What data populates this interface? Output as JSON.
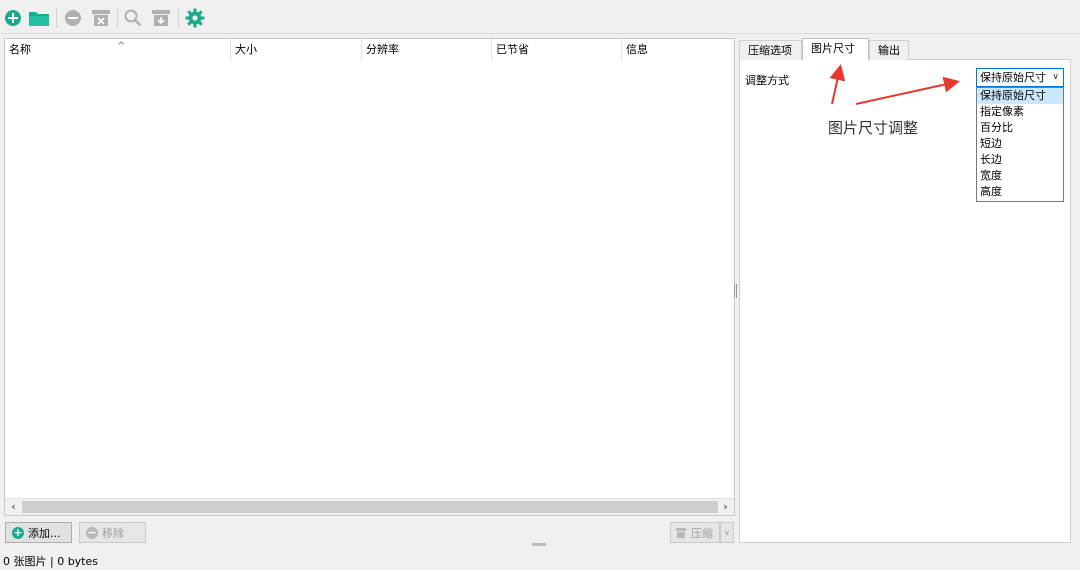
{
  "toolbar": {
    "icons": [
      "add-icon",
      "open-folder-icon",
      "remove-icon",
      "clear-icon",
      "search-icon",
      "save-icon",
      "settings-icon"
    ],
    "accent_color": "#1aaa8a",
    "disabled_color": "#b0b0b0"
  },
  "table": {
    "columns": [
      "名称",
      "大小",
      "分辨率",
      "已节省",
      "信息"
    ],
    "rows": []
  },
  "buttons": {
    "add": "添加...",
    "remove": "移除",
    "compress": "压缩"
  },
  "tabs": [
    "压缩选项",
    "图片尺寸",
    "输出"
  ],
  "resize": {
    "label": "调整方式",
    "selected": "保持原始尺寸",
    "options": [
      "保持原始尺寸",
      "指定像素",
      "百分比",
      "短边",
      "长边",
      "宽度",
      "高度"
    ]
  },
  "annotation": "图片尺寸调整",
  "status": "0 张图片 | 0 bytes"
}
